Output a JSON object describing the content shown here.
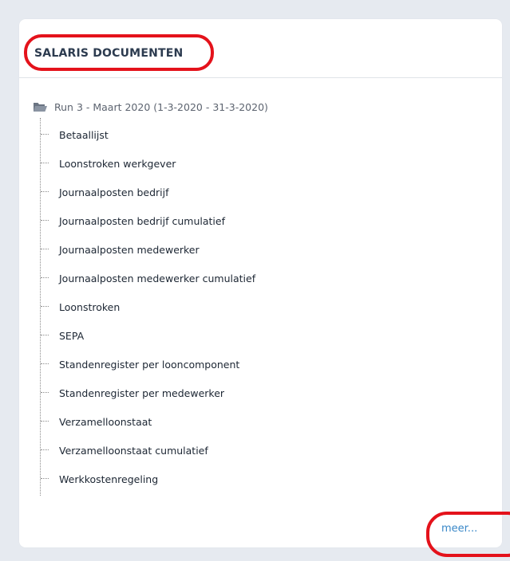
{
  "panel": {
    "title": "SALARIS DOCUMENTEN"
  },
  "tree": {
    "root_label": "Run 3 - Maart 2020 (1-3-2020 - 31-3-2020)",
    "root_icon": "folder-open-icon",
    "items": [
      "Betaallijst",
      "Loonstroken werkgever",
      "Journaalposten bedrijf",
      "Journaalposten bedrijf cumulatief",
      "Journaalposten medewerker",
      "Journaalposten medewerker cumulatief",
      "Loonstroken",
      "SEPA",
      "Standenregister per looncomponent",
      "Standenregister per medewerker",
      "Verzamelloonstaat",
      "Verzamelloonstaat cumulatief",
      "Werkkostenregeling"
    ]
  },
  "footer": {
    "more_label": "meer..."
  },
  "colors": {
    "highlight": "#e4121b",
    "link": "#3a88c8",
    "title": "#2c3b4f",
    "background": "#e6eaf0"
  }
}
